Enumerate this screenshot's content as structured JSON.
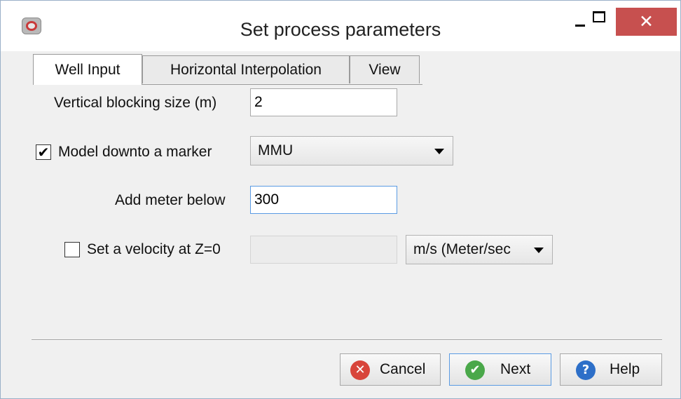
{
  "window": {
    "title": "Set process parameters",
    "controls": {
      "minimize": "—",
      "maximize": "□",
      "close": "✕"
    }
  },
  "tabs": [
    {
      "label": "Well Input",
      "active": true
    },
    {
      "label": "Horizontal Interpolation",
      "active": false
    },
    {
      "label": "View",
      "active": false
    }
  ],
  "form": {
    "vertical_blocking_label": "Vertical blocking size (m)",
    "vertical_blocking_value": "2",
    "model_downto_label": "Model downto a marker",
    "model_downto_checked": true,
    "marker_selected": "MMU",
    "add_meter_label": "Add meter below",
    "add_meter_value": "300",
    "velocity_label": "Set a velocity at Z=0",
    "velocity_checked": false,
    "velocity_value": "",
    "velocity_unit_selected": "m/s (Meter/sec"
  },
  "buttons": {
    "cancel": "Cancel",
    "next": "Next",
    "help": "Help"
  },
  "icons": {
    "check": "✔",
    "cancel_glyph": "✕",
    "next_glyph": "✔",
    "help_glyph": "?"
  },
  "colors": {
    "close_button": "#c7504f",
    "cancel_icon": "#d8453b",
    "next_icon": "#4aa84a",
    "help_icon": "#2d6fc8",
    "focus_border": "#5a9be3"
  }
}
